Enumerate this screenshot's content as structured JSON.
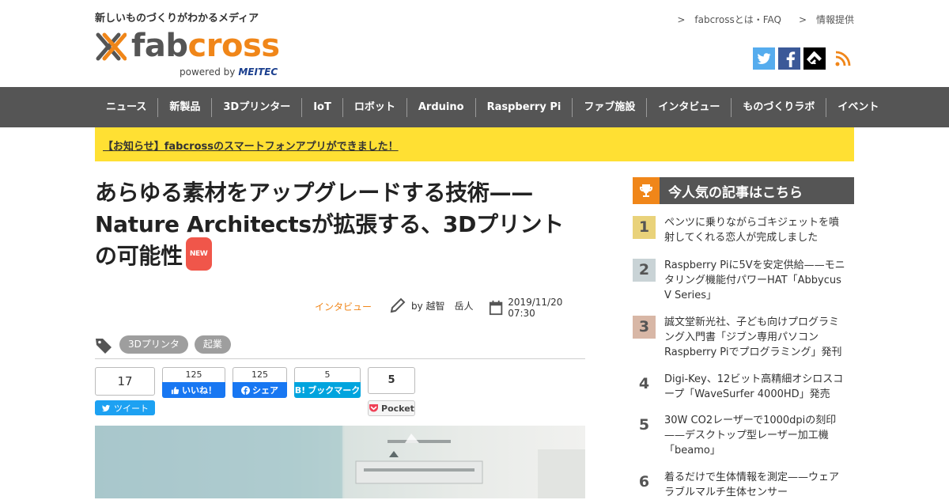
{
  "header": {
    "tagline": "新しいものづくりがわかるメディア",
    "logo_fab": "fab",
    "logo_cross": "cross",
    "logo_powered": "powered by",
    "logo_meitec": "MEITEC",
    "top_links": [
      ">　fabcrossとは・FAQ",
      ">　情報提供"
    ]
  },
  "socials": [
    "twitter-icon",
    "facebook-icon",
    "feedly-icon",
    "rss-icon"
  ],
  "nav": [
    "ニュース",
    "新製品",
    "3Dプリンター",
    "IoT",
    "ロボット",
    "Arduino",
    "Raspberry Pi",
    "ファブ施設",
    "インタビュー",
    "ものづくりラボ",
    "イベント"
  ],
  "notice": "【お知らせ】fabcrossのスマートフォンアプリができました！",
  "article": {
    "title_line1": "あらゆる素材をアップグレードする技術——",
    "title_line2": "Nature Architectsが拡張する、3Dプリント",
    "title_line3": "の可能性",
    "new_badge": "NEW",
    "category": "インタビュー",
    "author": "by 越智　岳人",
    "date": "2019/11/20 07:30",
    "tags": [
      "3Dプリンタ",
      "起業"
    ]
  },
  "share": {
    "tweet_count": "17",
    "tweet_label": "ツイート",
    "like_count": "125",
    "like_label": "いいね！",
    "share_count": "125",
    "share_label": "シェア",
    "hatena_count": "5",
    "hatena_label": "ブックマーク",
    "hatena_b": "B!",
    "pocket_count": "5",
    "pocket_label": "Pocket"
  },
  "sidebar": {
    "title": "今人気の記事はこちら",
    "ranking": [
      {
        "rank": "1",
        "color": "#e9d27a",
        "lines": [
          "ペンツに乗りながらゴキジェットを噴",
          "射してくれる恋人が完成しました"
        ]
      },
      {
        "rank": "2",
        "color": "#c9d3d6",
        "lines": [
          "Raspberry Piに5Vを安定供給——モニ",
          "タリング機能付パワーHAT「Abbycus",
          "V Series」"
        ]
      },
      {
        "rank": "3",
        "color": "#d8b7a6",
        "lines": [
          "誠文堂新光社、子ども向けプログラミ",
          "ング入門書「ジブン専用パソコン",
          "Raspberry Piでプログラミング」発刊"
        ]
      },
      {
        "rank": "4",
        "color": "",
        "lines": [
          "Digi-Key、12ビット高精細オシロスコ",
          "ープ「WaveSurfer 4000HD」発売"
        ]
      },
      {
        "rank": "5",
        "color": "",
        "lines": [
          "30W CO2レーザーで1000dpiの刻印",
          "——デスクトップ型レーザー加工機",
          "「beamo」"
        ]
      },
      {
        "rank": "6",
        "color": "",
        "lines": [
          "着るだけで生体情報を測定——ウェア",
          "ラブルマルチ生体センサー"
        ]
      }
    ]
  }
}
